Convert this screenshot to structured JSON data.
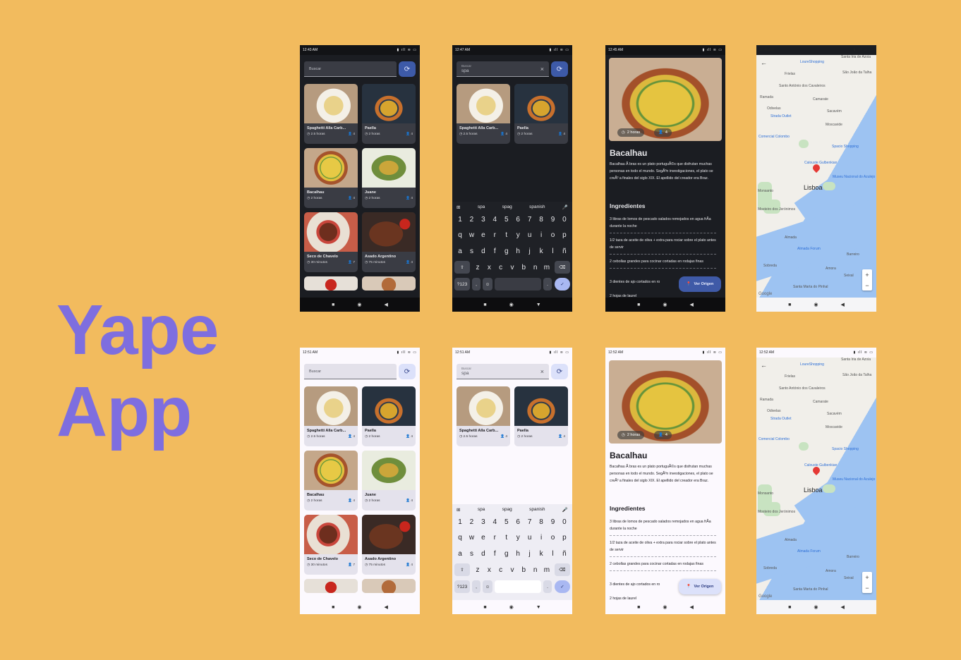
{
  "brand": {
    "line1": "Yape",
    "line2": "App",
    "color": "#7E6EDF",
    "background": "#F2BB5E"
  },
  "screens": {
    "list_dark": {
      "time": "12:43 AM",
      "search_placeholder": "Buscar"
    },
    "search_dark": {
      "time": "12:47 AM",
      "search_label": "Buscar",
      "search_value": "spa"
    },
    "detail_dark": {
      "time": "12:45 AM"
    },
    "map_dark": {
      "time": "12:46 AM"
    },
    "list_light": {
      "time": "12:51 AM",
      "search_placeholder": "Buscar"
    },
    "search_light": {
      "time": "12:51 AM",
      "search_label": "Buscar",
      "search_value": "spa"
    },
    "detail_light": {
      "time": "12:52 AM"
    },
    "map_light": {
      "time": "12:52 AM"
    }
  },
  "recipes": [
    {
      "name": "Spaghetti Alla Carb...",
      "time": "2.5 horas",
      "servings": "4",
      "image": "f-spag"
    },
    {
      "name": "Paella",
      "time": "2 horas",
      "servings": "4",
      "image": "f-paella"
    },
    {
      "name": "Bacalhau",
      "time": "2 horas",
      "servings": "4",
      "image": "f-bac"
    },
    {
      "name": "Juane",
      "time": "2 horas",
      "servings": "4",
      "image": "f-juane"
    },
    {
      "name": "Seco de Chavelo",
      "time": "30 minutos",
      "servings": "7",
      "image": "f-seco"
    },
    {
      "name": "Asado Argentino",
      "time": "75 minutos",
      "servings": "4",
      "image": "f-asado"
    }
  ],
  "keyboard": {
    "suggestions": [
      "spa",
      "spag",
      "spanish"
    ],
    "row_numbers": [
      "1",
      "2",
      "3",
      "4",
      "5",
      "6",
      "7",
      "8",
      "9",
      "0"
    ],
    "row1": [
      "q",
      "w",
      "e",
      "r",
      "t",
      "y",
      "u",
      "i",
      "o",
      "p"
    ],
    "row2": [
      "a",
      "s",
      "d",
      "f",
      "g",
      "h",
      "j",
      "k",
      "l",
      "ñ"
    ],
    "row3": [
      "z",
      "x",
      "c",
      "v",
      "b",
      "n",
      "m"
    ],
    "symbols_key": "?123",
    "comma_key": ",",
    "period_key": "."
  },
  "detail": {
    "time_pill": "2 horas",
    "servings_pill": "4",
    "title": "Bacalhau",
    "description": "Bacalhau Ã  bras es un plato portuguÃ©s que disfrutan muchas personas en todo el mundo. SegÃºn investigaciones, el plato se creÃ³ a finales del siglo XIX. El apellido del creador era Braz.",
    "ingredients_title": "Ingredientes",
    "ingredients": [
      "3 libras de lomos de pescado salados remojados en agua frÃ­a durante la noche",
      "1/2 taza de aceite de oliva + extra para rociar sobre el plato antes de servir",
      "2 cebollas grandes para cocinar cortadas en rodajas finas",
      "3 dientes de ajo cortados en ro",
      "2 hojas de laurel"
    ],
    "fab_label": "Ver Origen"
  },
  "map": {
    "labels": [
      "Santa Iria de Azoia",
      "LoureShopping",
      "Frielas",
      "São João da Talha",
      "Santo António dos Cavaleiros",
      "Ramada",
      "Camarate",
      "Odivelas",
      "Strada Outlet",
      "Sacavém",
      "Comercial Colombo",
      "Moscavide",
      "Spacio Shopping",
      "Calouste Gulbenkian",
      "Lisboa",
      "Museu Nacional do Azulejo",
      "Mosteiro dos Jerónimos",
      "Almada",
      "Almada Forum",
      "Barreiro",
      "Seixal",
      "Sobreda",
      "Santa Marta do Pinhal",
      "Amora",
      "Monsanto"
    ],
    "city": "Lisboa",
    "google": "Google",
    "zoom_in": "+",
    "zoom_out": "−"
  }
}
